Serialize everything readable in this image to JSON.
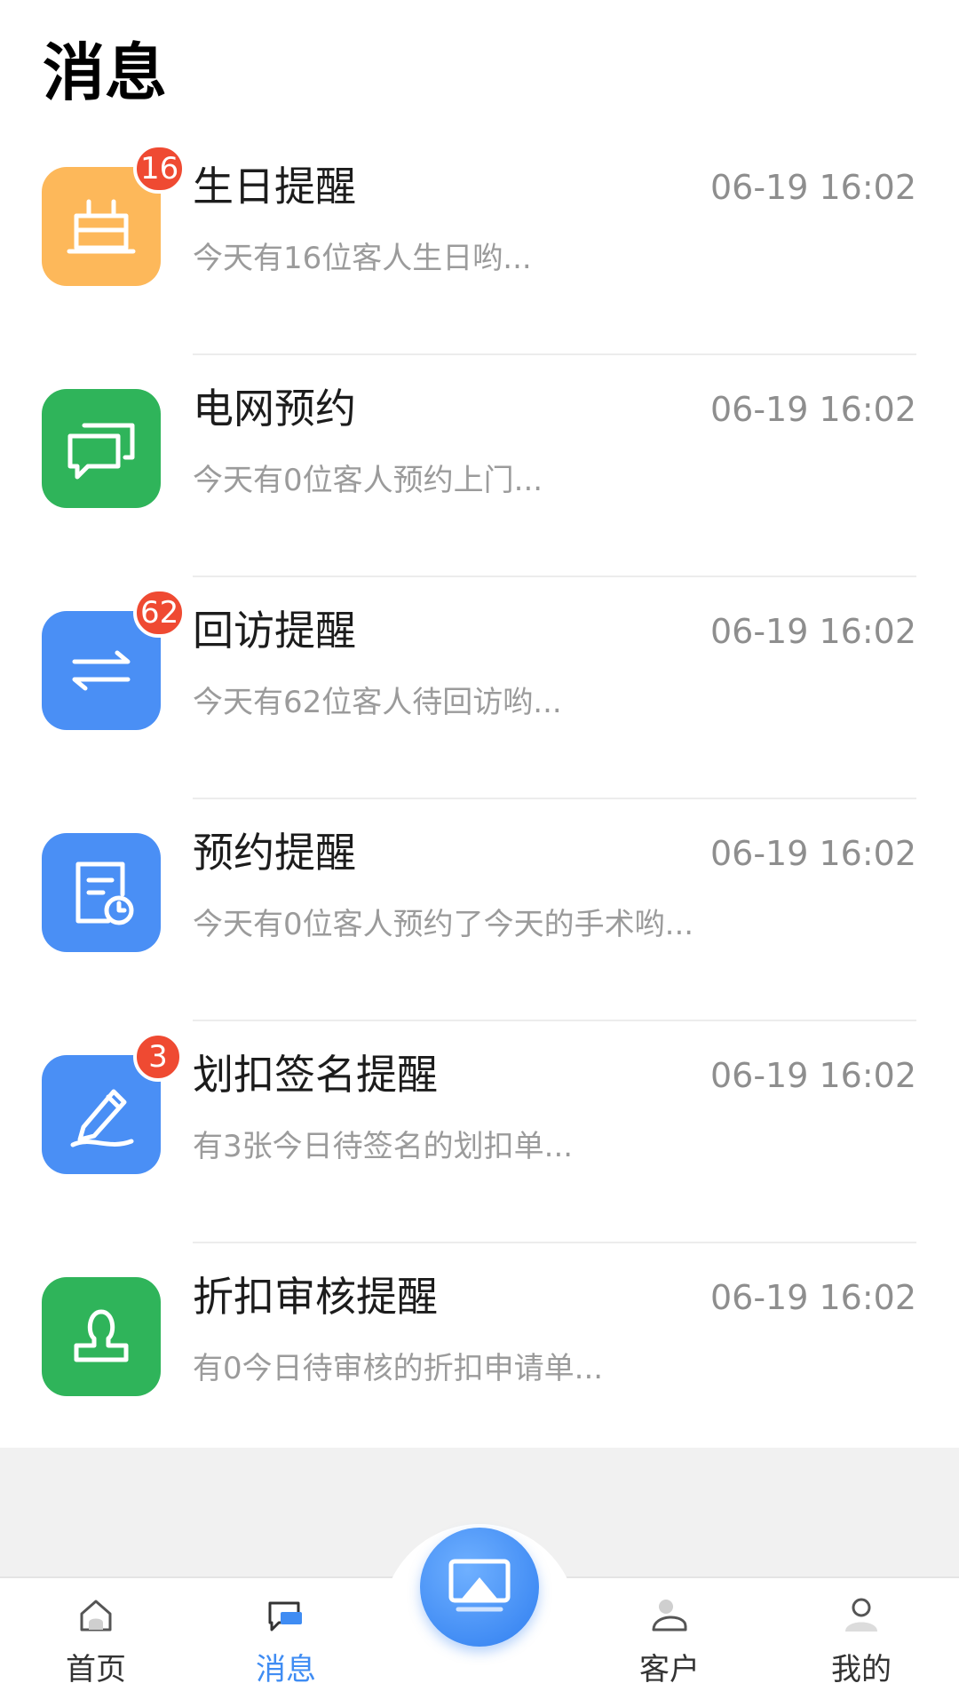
{
  "page": {
    "title": "消息"
  },
  "messages": [
    {
      "title": "生日提醒",
      "time": "06-19 16:02",
      "preview": "今天有16位客人生日哟...",
      "badge": "16",
      "icon": "cake-icon",
      "color": "#fdb85a"
    },
    {
      "title": "电网预约",
      "time": "06-19 16:02",
      "preview": "今天有0位客人预约上门...",
      "badge": "",
      "icon": "chat-bubbles-icon",
      "color": "#2fb45a"
    },
    {
      "title": "回访提醒",
      "time": "06-19 16:02",
      "preview": "今天有62位客人待回访哟...",
      "badge": "62",
      "icon": "exchange-arrows-icon",
      "color": "#4a8ff5"
    },
    {
      "title": "预约提醒",
      "time": "06-19 16:02",
      "preview": "今天有0位客人预约了今天的手术哟...",
      "badge": "",
      "icon": "document-clock-icon",
      "color": "#4a8ff5"
    },
    {
      "title": "划扣签名提醒",
      "time": "06-19 16:02",
      "preview": "有3张今日待签名的划扣单...",
      "badge": "3",
      "icon": "pen-signature-icon",
      "color": "#4a8ff5"
    },
    {
      "title": "折扣审核提醒",
      "time": "06-19 16:02",
      "preview": "有0今日待审核的折扣申请单...",
      "badge": "",
      "icon": "stamp-icon",
      "color": "#2fb45a"
    }
  ],
  "tabbar": {
    "home_label": "首页",
    "messages_label": "消息",
    "customers_label": "客户",
    "mine_label": "我的",
    "active_color": "#3f8cf3"
  }
}
